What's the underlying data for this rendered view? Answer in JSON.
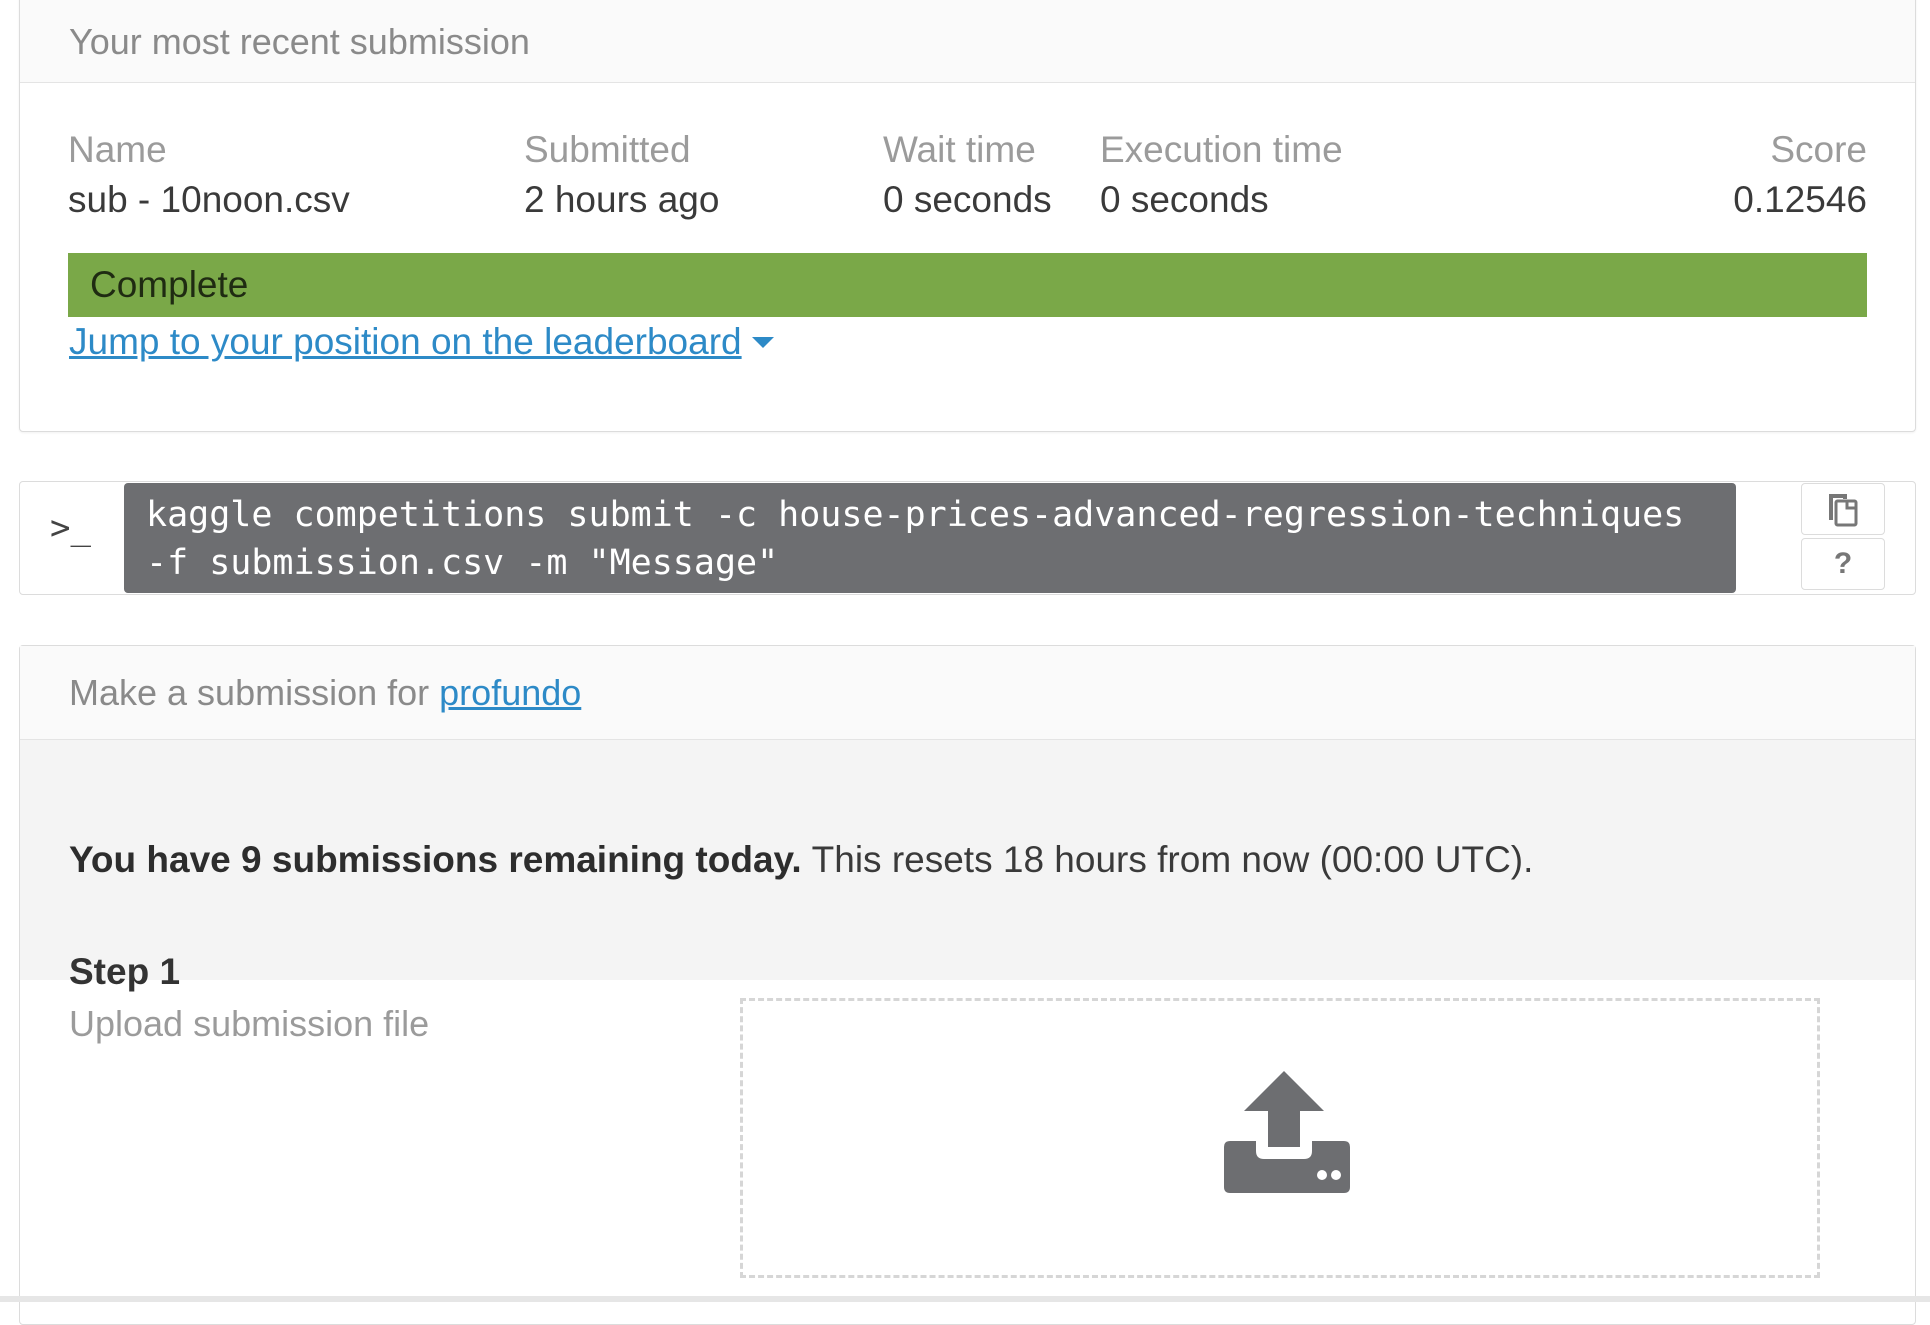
{
  "recent": {
    "title": "Your most recent submission",
    "columns": {
      "name": {
        "label": "Name",
        "value": "sub - 10noon.csv"
      },
      "submitted": {
        "label": "Submitted",
        "value": "2 hours ago"
      },
      "wait": {
        "label": "Wait time",
        "value": "0 seconds"
      },
      "execution": {
        "label": "Execution time",
        "value": "0 seconds"
      },
      "score": {
        "label": "Score",
        "value": "0.12546"
      }
    },
    "status": "Complete",
    "status_color": "#7aa848",
    "jump_link": "Jump to your position on the leaderboard"
  },
  "command": {
    "prompt": ">_",
    "text": "kaggle competitions submit -c house-prices-advanced-regression-techniques -f submission.csv -m \"Message\"",
    "copy_icon": "copy-icon",
    "help_label": "?"
  },
  "make": {
    "title_prefix": "Make a submission for",
    "team_link": "profundo",
    "notice_bold": "You have 9 submissions remaining today.",
    "notice_rest": "This resets 18 hours from now (00:00 UTC).",
    "step_title": "Step 1",
    "step_sub": "Upload submission file",
    "upload_icon": "upload-icon"
  },
  "colors": {
    "link": "#2d8ac7",
    "command_bg": "#6d6e71"
  }
}
